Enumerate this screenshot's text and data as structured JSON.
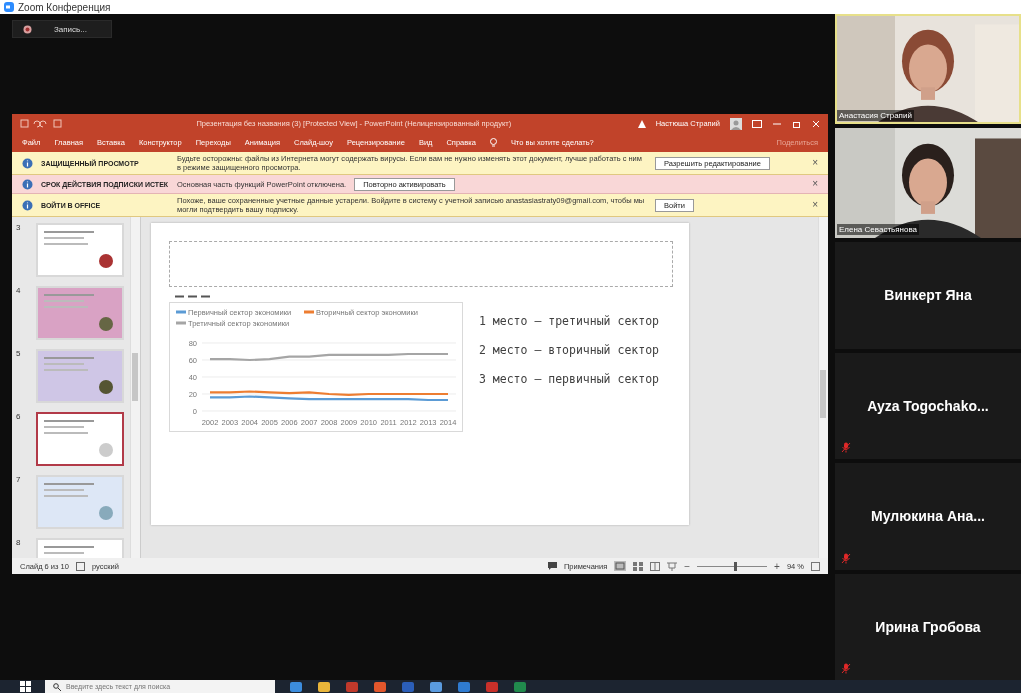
{
  "app_title": "Zoom Конференция",
  "recording": {
    "label": "Запись..."
  },
  "powerpoint": {
    "title": "Презентация без названия (3) [Protected View] - PowerPoint (Нелицензированный продукт)",
    "user": "Настюша Страпий",
    "tabs": [
      {
        "label": "Файл"
      },
      {
        "label": "Главная"
      },
      {
        "label": "Вставка"
      },
      {
        "label": "Конструктор"
      },
      {
        "label": "Переходы"
      },
      {
        "label": "Анимация"
      },
      {
        "label": "Слайд-шоу"
      },
      {
        "label": "Рецензирование"
      },
      {
        "label": "Вид"
      },
      {
        "label": "Справка"
      }
    ],
    "tell_me": "Что вы хотите сделать?",
    "share": "Поделиться",
    "message_bars": [
      {
        "kind": "warning",
        "title": "ЗАЩИЩЕННЫЙ ПРОСМОТР",
        "text": "Будьте осторожны: файлы из Интернета могут содержать вирусы. Если вам не нужно изменять этот документ, лучше работать с ним в режиме защищенного просмотра.",
        "button": "Разрешить редактирование",
        "close": "×"
      },
      {
        "kind": "error",
        "title": "СРОК ДЕЙСТВИЯ ПОДПИСКИ ИСТЕК",
        "text": "Основная часть функций PowerPoint отключена.",
        "button": "Повторно активировать",
        "close": "×"
      },
      {
        "kind": "warning",
        "title": "ВОЙТИ В OFFICE",
        "text": "Похоже, ваше сохраненные учетные данные устарели. Войдите в систему с учетной записью anastasiastraty09@gmail.com, чтобы мы могли подтвердить вашу подписку.",
        "button": "Войти",
        "close": "×"
      }
    ],
    "thumbnails": [
      {
        "number": "3",
        "selected": false
      },
      {
        "number": "4",
        "selected": false
      },
      {
        "number": "5",
        "selected": false
      },
      {
        "number": "6",
        "selected": true
      },
      {
        "number": "7",
        "selected": false
      },
      {
        "number": "8",
        "selected": false
      }
    ],
    "slide": {
      "chart_data": {
        "type": "line",
        "grid": true,
        "legend": true,
        "categories": [
          "2002",
          "2003",
          "2004",
          "2005",
          "2006",
          "2007",
          "2008",
          "2009",
          "2010",
          "2011",
          "2012",
          "2013",
          "2014"
        ],
        "ylim": [
          0,
          80
        ],
        "yticks": [
          0,
          20,
          40,
          60,
          80
        ],
        "series": [
          {
            "name": "Первичный сектор экономики",
            "color": "#5b9bd5",
            "values": [
              16,
              16,
              17,
              16,
              15,
              14,
              14,
              14,
              14,
              14,
              14,
              13,
              13
            ]
          },
          {
            "name": "Вторичный сектор экономики",
            "color": "#ed7d31",
            "values": [
              22,
              22,
              23,
              22,
              21,
              22,
              20,
              19,
              20,
              20,
              20,
              20,
              20
            ]
          },
          {
            "name": "Третичный сектор экономики",
            "color": "#a5a5a5",
            "values": [
              61,
              61,
              60,
              61,
              64,
              64,
              66,
              66,
              66,
              66,
              67,
              67,
              67
            ]
          }
        ]
      },
      "lines": [
        "1 место – третичный сектор",
        "2 место – вторичный сектор",
        "3 место – первичный сектор"
      ]
    },
    "status": {
      "slide_info": "Слайд 6 из 10",
      "language": "русский",
      "notes": "Примечания",
      "zoom": "94 %",
      "zoom_out": "−",
      "zoom_in": "+",
      "zoom_slider": {
        "level": 0.55
      }
    }
  },
  "participants": [
    {
      "kind": "video",
      "name": "Анастасия Страпий"
    },
    {
      "kind": "video",
      "name": "Елена Севастьянова"
    },
    {
      "kind": "name",
      "name": "Винкерт Яна",
      "muted": false
    },
    {
      "kind": "name",
      "name": "Ayza  Togochako...",
      "muted": true
    },
    {
      "kind": "name",
      "name": "Мулюкина  Ана...",
      "muted": true
    },
    {
      "kind": "name",
      "name": "Ирина Гробова",
      "muted": true
    }
  ],
  "taskbar": {
    "search_placeholder": "Введите здесь текст для поиска"
  }
}
